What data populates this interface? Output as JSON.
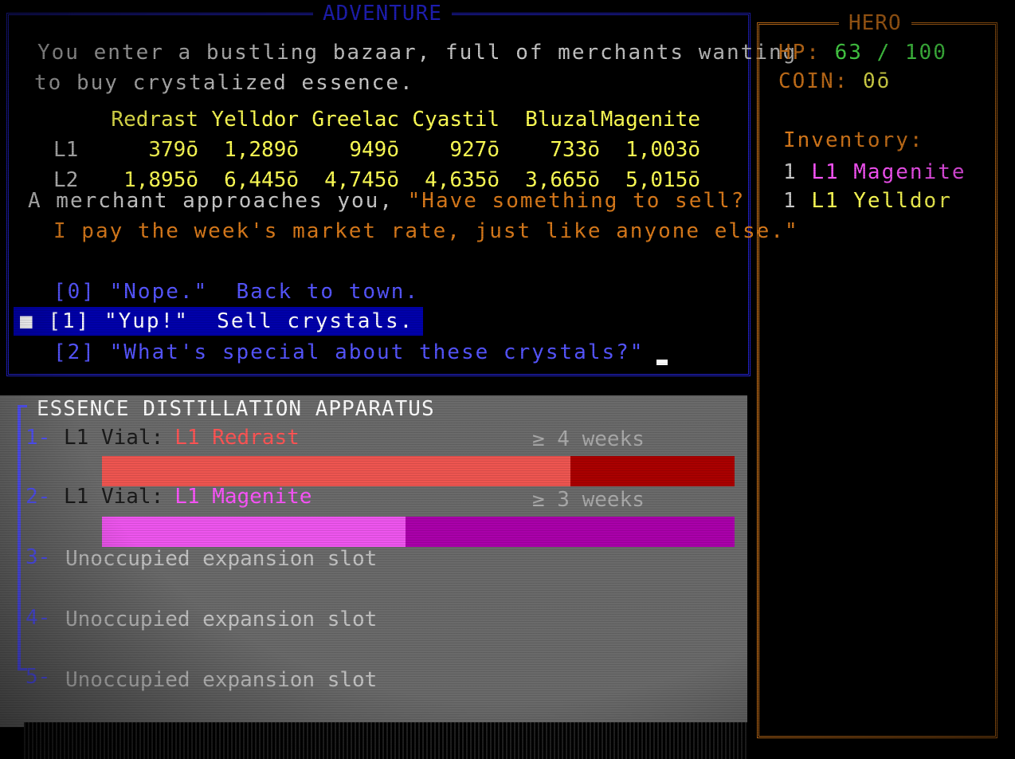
{
  "adventure": {
    "title": "ADVENTURE",
    "intro_1": "You enter a bustling bazaar, full of merchants wanting",
    "intro_2": "to buy crystalized essence.",
    "crystals": [
      "Redrast",
      "Yelldor",
      "Greelac",
      "Cyastil",
      "Bluzal",
      "Magenite"
    ],
    "rows": [
      {
        "label": "L1",
        "prices": [
          "379ō",
          "1,289ō",
          "949ō",
          "927ō",
          "733ō",
          "1,003ō"
        ]
      },
      {
        "label": "L2",
        "prices": [
          "1,895ō",
          "6,445ō",
          "4,745ō",
          "4,635ō",
          "3,665ō",
          "5,015ō"
        ]
      }
    ],
    "merchant_prefix": "A merchant approaches you, ",
    "merchant_quote_1": "\"Have something to sell?",
    "merchant_quote_2": "I pay the week's market rate, just like anyone else.\"",
    "options": [
      {
        "key": "[0]",
        "text": "\"Nope.\"  Back to town."
      },
      {
        "key": "[1]",
        "text": "\"Yup!\"  Sell crystals."
      },
      {
        "key": "[2]",
        "text": "\"What's special about these crystals?\""
      }
    ],
    "selected_option": 1
  },
  "hero": {
    "title": "HERO",
    "hp_label": "HP:",
    "hp_value": "63 / 100",
    "coin_label": "COIN:",
    "coin_value": "0ō",
    "inventory_label": "Inventory:",
    "inventory": [
      {
        "qty": "1",
        "name": "L1 Magenite"
      },
      {
        "qty": "1",
        "name": "L1 Yelldor"
      }
    ]
  },
  "apparatus": {
    "title": "ESSENCE DISTILLATION APPARATUS",
    "slots": [
      {
        "num": "1-",
        "label": "L1 Vial:",
        "crystal": "L1 Redrast",
        "weeks": "≥ 4 weeks",
        "progress": 0.74,
        "fill": "#ee5550",
        "track": "#aa0000"
      },
      {
        "num": "2-",
        "label": "L1 Vial:",
        "crystal": "L1 Magenite",
        "weeks": "≥ 3 weeks",
        "progress": 0.48,
        "fill": "#ee55ee",
        "track": "#aa00aa"
      },
      {
        "num": "3-",
        "empty": "Unoccupied expansion slot"
      },
      {
        "num": "4-",
        "empty": "Unoccupied expansion slot"
      },
      {
        "num": "5-",
        "empty": "Unoccupied expansion slot"
      }
    ]
  },
  "colors": {
    "adventure_border": "#2222cc",
    "hero_border": "#d97a1b",
    "highlight": "#0000aa"
  }
}
